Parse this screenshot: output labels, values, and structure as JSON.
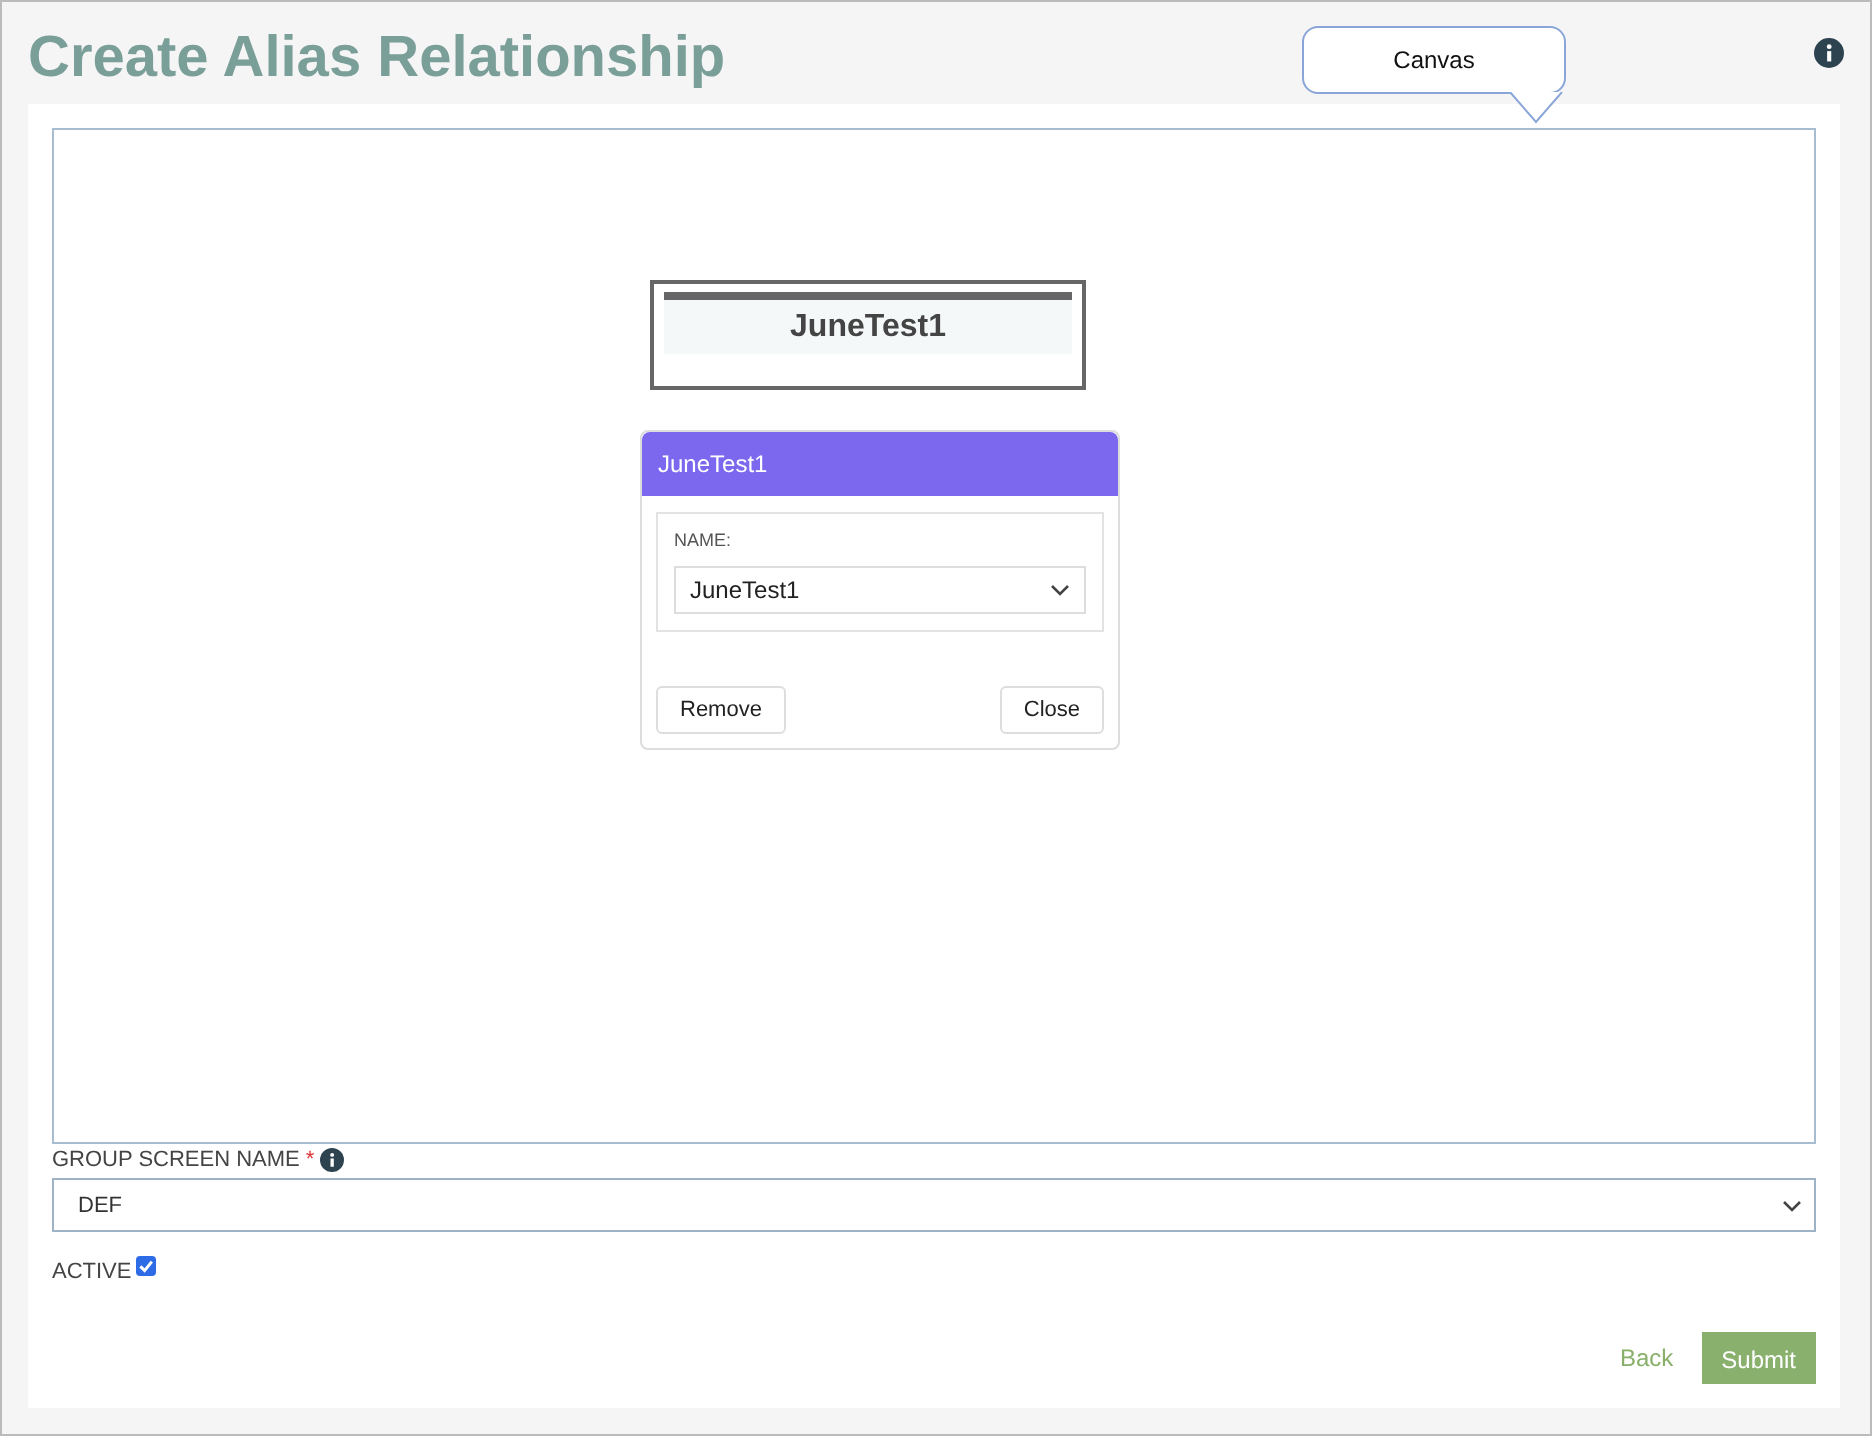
{
  "page": {
    "title": "Create Alias Relationship"
  },
  "tooltip": {
    "text": "Canvas"
  },
  "canvas": {
    "node": {
      "title": "JuneTest1"
    },
    "popup": {
      "title": "JuneTest1",
      "field_label": "NAME:",
      "field_value": "JuneTest1",
      "buttons": [
        "Remove",
        "Close"
      ]
    }
  },
  "group_screen_name": {
    "label": "GROUP SCREEN NAME",
    "required_mark": "*",
    "value": "DEF"
  },
  "active": {
    "label": "ACTIVE",
    "checked": true
  },
  "actions": {
    "back": "Back",
    "submit": "Submit"
  }
}
